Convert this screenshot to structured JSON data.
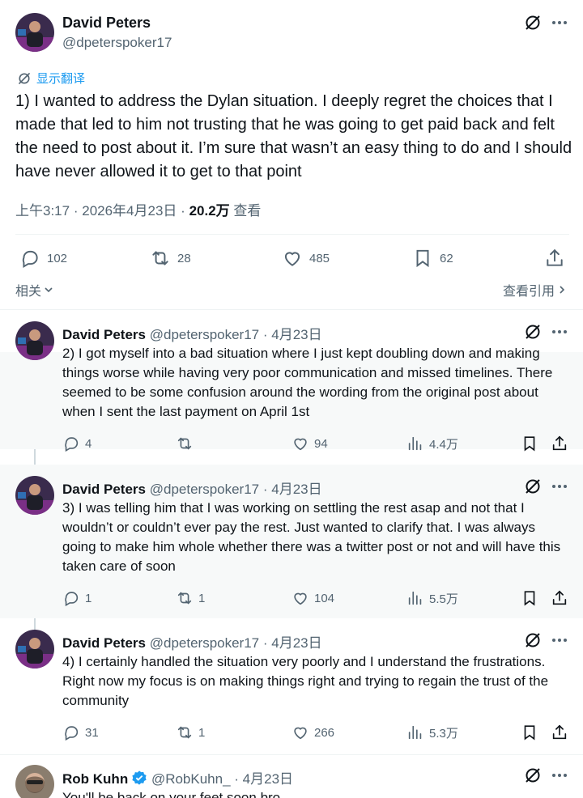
{
  "main_tweet": {
    "author_name": "David Peters",
    "author_handle": "@dpeterspoker17",
    "translate_label": "显示翻译",
    "text": "1) I wanted to address the Dylan situation. I deeply regret the choices that I made that led to him not trusting that he was going to get paid back and felt the need to post about it. I’m sure that wasn’t an easy thing to do and I should have never allowed it to get to that point",
    "time": "上午3:17",
    "date": "2026年4月23日",
    "views": "20.2万",
    "views_label": "查看",
    "dot": "·",
    "stats": {
      "replies": "102",
      "reposts": "28",
      "likes": "485",
      "bookmarks": "62"
    },
    "related_label": "相关",
    "quotes_label": "查看引用"
  },
  "replies": [
    {
      "name": "David Peters",
      "handle": "@dpeterspoker17",
      "date": "· 4月23日",
      "text": "2) I got myself into a bad situation where I just kept doubling down and making things worse while having very poor communication and missed timelines.   There seemed to be some confusion around the wording from the original post about when I sent the last payment on April 1st",
      "replies": "4",
      "reposts": "",
      "likes": "94",
      "views": "4.4万"
    },
    {
      "name": "David Peters",
      "handle": "@dpeterspoker17",
      "date": "· 4月23日",
      "text": "3) I was telling him that I was working on settling the rest asap and not that I wouldn’t or couldn’t ever pay the rest. Just wanted to clarify that. I was always going to make him whole whether there was a twitter post or not and will have this taken care of soon",
      "replies": "1",
      "reposts": "1",
      "likes": "104",
      "views": "5.5万"
    },
    {
      "name": "David Peters",
      "handle": "@dpeterspoker17",
      "date": "· 4月23日",
      "text": "4) I certainly handled the situation very poorly and I understand the frustrations. Right now my focus is on making things right and trying to regain the trust of the community",
      "replies": "31",
      "reposts": "1",
      "likes": "266",
      "views": "5.3万"
    },
    {
      "name": "Rob Kuhn",
      "handle": "@RobKuhn_",
      "date": "· 4月23日",
      "text": "You'll be back on your feet soon bro"
    }
  ],
  "colors": {
    "accent": "#1d9bf0",
    "muted": "#536471",
    "text": "#0f1419",
    "shade": "#f7f9f9"
  }
}
